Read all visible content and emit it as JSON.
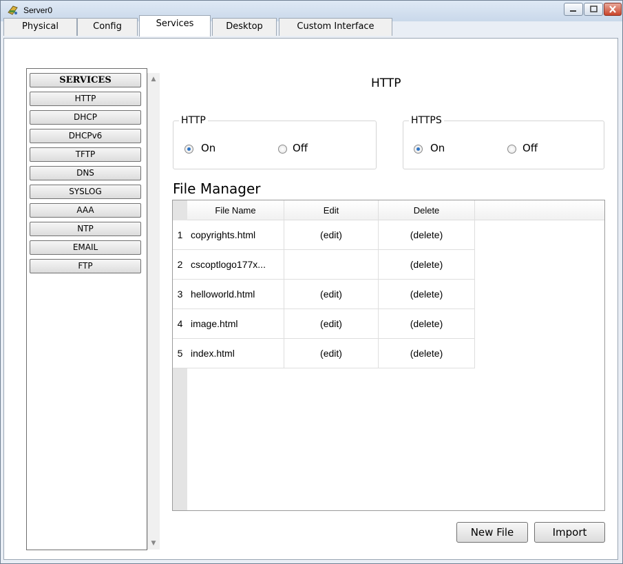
{
  "window": {
    "title": "Server0"
  },
  "tabs": [
    {
      "label": "Physical"
    },
    {
      "label": "Config"
    },
    {
      "label": "Services"
    },
    {
      "label": "Desktop"
    },
    {
      "label": "Custom Interface"
    }
  ],
  "active_tab": "Services",
  "services": {
    "header": "SERVICES",
    "items": [
      {
        "label": "HTTP"
      },
      {
        "label": "DHCP"
      },
      {
        "label": "DHCPv6"
      },
      {
        "label": "TFTP"
      },
      {
        "label": "DNS"
      },
      {
        "label": "SYSLOG"
      },
      {
        "label": "AAA"
      },
      {
        "label": "NTP"
      },
      {
        "label": "EMAIL"
      },
      {
        "label": "FTP"
      }
    ]
  },
  "main": {
    "heading": "HTTP",
    "http_group": {
      "title": "HTTP",
      "on_label": "On",
      "off_label": "Off",
      "selected": "On"
    },
    "https_group": {
      "title": "HTTPS",
      "on_label": "On",
      "off_label": "Off",
      "selected": "On"
    },
    "file_manager": {
      "title": "File Manager",
      "columns": [
        "File Name",
        "Edit",
        "Delete"
      ],
      "rows": [
        {
          "num": "1",
          "name": "copyrights.html",
          "edit": "(edit)",
          "delete": "(delete)"
        },
        {
          "num": "2",
          "name": "cscoptlogo177x...",
          "edit": "",
          "delete": "(delete)"
        },
        {
          "num": "3",
          "name": "helloworld.html",
          "edit": "(edit)",
          "delete": "(delete)"
        },
        {
          "num": "4",
          "name": "image.html",
          "edit": "(edit)",
          "delete": "(delete)"
        },
        {
          "num": "5",
          "name": "index.html",
          "edit": "(edit)",
          "delete": "(delete)"
        }
      ]
    },
    "buttons": {
      "new_file": "New File",
      "import": "Import"
    }
  },
  "colors": {
    "radio_checked": "#2f74c4",
    "close_button": "#c9442a"
  }
}
